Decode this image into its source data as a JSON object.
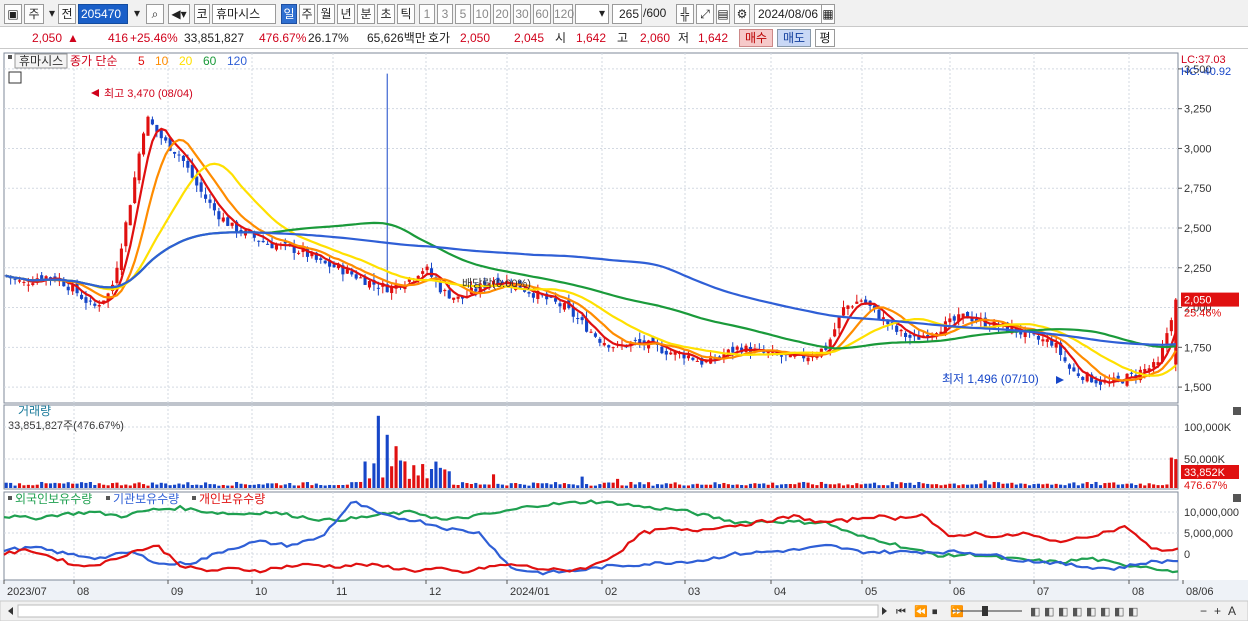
{
  "toolbar": {
    "type_label": "주",
    "prev_label": "전",
    "code": "205470",
    "market_prefix": "코",
    "stock_name": "휴마시스",
    "periods": [
      "일",
      "주",
      "월",
      "년",
      "분",
      "초",
      "틱"
    ],
    "active_period": "일",
    "intervals": [
      "1",
      "3",
      "5",
      "10",
      "20",
      "30",
      "60",
      "120"
    ],
    "count": "265",
    "count_total": "/600",
    "date": "2024/08/06"
  },
  "quote": {
    "price": "2,050",
    "arrow": "▲",
    "change": "416",
    "change_pct": "+25.46%",
    "volume": "33,851,827",
    "volume_ratio": "476.67%",
    "turnover": "26.17%",
    "amount": "65,626백만",
    "bid_label": "호가",
    "ask_price": "2,050",
    "bid_price": "2,045",
    "open_label": "시",
    "open": "1,642",
    "high_label": "고",
    "high": "2,060",
    "low_label": "저",
    "low": "1,642",
    "buy_label": "매수",
    "sell_label": "매도",
    "eval_label": "평"
  },
  "colors": {
    "up": "#e01010",
    "down": "#1646c8",
    "ma5": "#e01010",
    "ma10": "#ff8c00",
    "ma20": "#ffe000",
    "ma60": "#1a9a3a",
    "ma120": "#2f5fd6",
    "foreign": "#1fa050",
    "institution": "#2f5fd6",
    "individual": "#e01010"
  },
  "chart_data": [
    {
      "type": "candlestick",
      "title": "휴마시스",
      "legend": {
        "title": "종가 단순",
        "periods": [
          "5",
          "10",
          "20",
          "60",
          "120"
        ]
      },
      "x": [
        "2023/07",
        "08",
        "09",
        "10",
        "11",
        "12",
        "2024/01",
        "02",
        "03",
        "04",
        "05",
        "06",
        "07",
        "08",
        "08/06"
      ],
      "ylim": [
        1400,
        3600
      ],
      "yticks": [
        "3,500",
        "3,250",
        "3,000",
        "2,750",
        "2,500",
        "2,250",
        "2,000",
        "1,750",
        "1,500"
      ],
      "grid": true,
      "lc": "LC:37.03",
      "hc": "HC:-40.92",
      "close_path": [
        2200,
        2150,
        2200,
        2180,
        2100,
        2000,
        2100,
        2600,
        3200,
        3050,
        2950,
        2750,
        2600,
        2500,
        2450,
        2400,
        2380,
        2350,
        2280,
        2250,
        2200,
        2150,
        2120,
        2180,
        2250,
        2100,
        2050,
        2120,
        2180,
        2150,
        2100,
        2050,
        2000,
        1900,
        1800,
        1750,
        1780,
        1760,
        1720,
        1700,
        1650,
        1700,
        1750,
        1720,
        1700,
        1680,
        1700,
        1750,
        2000,
        2050,
        1950,
        1850,
        1800,
        1850,
        1900,
        1950,
        1900,
        1880,
        1850,
        1800,
        1780,
        1600,
        1560,
        1520,
        1550,
        1600,
        1640,
        2050
      ],
      "last_price": "2,050",
      "last_change_pct": "25.46%",
      "annotations": [
        {
          "text": "최고 3,470 (08/04)",
          "value": 3470
        },
        {
          "text": "최저 1,496 (07/10)",
          "value": 1496
        },
        {
          "text": "배당락(0.00%)"
        }
      ]
    },
    {
      "type": "bar",
      "title": "거래량",
      "summary": "33,851,827주(476.67%)",
      "yticks": [
        "100,000K",
        "50,000K"
      ],
      "last_value": "33,852K",
      "last_ratio": "476.67%"
    },
    {
      "type": "line",
      "series": [
        {
          "name": "외국인보유수량",
          "color_key": "foreign"
        },
        {
          "name": "기관보유수량",
          "color_key": "institution"
        },
        {
          "name": "개인보유수량",
          "color_key": "individual"
        }
      ],
      "yticks": [
        "10,000,000",
        "5,000,000",
        "0"
      ],
      "foreign_path": [
        9.0,
        8.5,
        9.5,
        10.0,
        9.0,
        10.5,
        11.0,
        10.0,
        9.5,
        10.0,
        9.0,
        8.0,
        8.5,
        9.5,
        10.0,
        8.0,
        9.0,
        10.0,
        11.5,
        12.0,
        12.5,
        12.0,
        11.0,
        10.5,
        9.0,
        7.5,
        7.8,
        7.6,
        7.5,
        4.5,
        3.0,
        1.0,
        -0.5,
        0.0,
        -1.0,
        -1.5,
        -2.0,
        -1.0,
        -2.5,
        -3.0,
        -4.5
      ],
      "inst_path": [
        1.0,
        1.5,
        0.0,
        -1.0,
        0.5,
        -2.5,
        -2.0,
        1.0,
        3.0,
        2.0,
        4.0,
        12.5,
        9.0,
        8.0,
        6.0,
        5.0,
        -3.5,
        -4.5,
        -4.0,
        -3.0,
        -2.5,
        -2.0,
        -1.5,
        0.0,
        0.5,
        1.0,
        2.0,
        0.5,
        0.5,
        0.5,
        0.5,
        0.0,
        -1.5,
        -2.0,
        -3.0,
        -3.5,
        -2.0,
        -1.5
      ],
      "indiv_path": [
        0.0,
        1.0,
        -1.0,
        -3.0,
        -2.0,
        0.5,
        2.0,
        -3.0,
        -4.0,
        -3.5,
        -4.0,
        -3.0,
        -2.5,
        -3.0,
        -2.5,
        -3.0,
        -4.0,
        -3.5,
        -4.5,
        -3.0,
        -2.5,
        -3.5,
        -4.0,
        -3.0,
        0.0,
        5.0,
        6.0,
        5.5,
        6.5,
        7.0,
        8.0,
        9.0,
        7.5,
        8.0,
        9.0,
        8.5,
        9.5,
        4.0,
        5.0,
        4.0,
        5.0,
        3.0,
        3.5,
        5.0,
        6.5,
        1.0,
        1.0
      ]
    }
  ]
}
